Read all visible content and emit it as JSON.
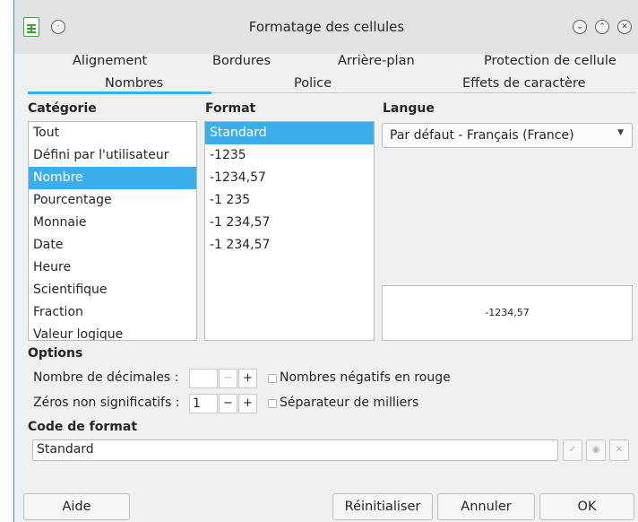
{
  "window": {
    "title": "Formatage des cellules"
  },
  "tabs_row1": [
    "Alignement",
    "Bordures",
    "Arrière-plan",
    "Protection de cellule"
  ],
  "tabs_row2": [
    "Nombres",
    "Police",
    "Effets de caractère"
  ],
  "active_tab": "Nombres",
  "category": {
    "header": "Catégorie",
    "items": [
      "Tout",
      "Défini par l'utilisateur",
      "Nombre",
      "Pourcentage",
      "Monnaie",
      "Date",
      "Heure",
      "Scientifique",
      "Fraction",
      "Valeur logique"
    ],
    "selected": "Nombre"
  },
  "format": {
    "header": "Format",
    "items": [
      "Standard",
      "-1235",
      "-1234,57",
      "-1 235",
      "-1 234,57",
      "-1 234,57"
    ],
    "selected": "Standard"
  },
  "language": {
    "header": "Langue",
    "value": "Par défaut - Français (France)"
  },
  "preview": {
    "value": "-1234,57"
  },
  "options": {
    "header": "Options",
    "decimals_label": "Nombre de décimales :",
    "decimals_value": "",
    "leading_zeros_label": "Zéros non significatifs :",
    "leading_zeros_value": "1",
    "negative_red_label": "Nombres négatifs en rouge",
    "negative_red_checked": false,
    "thousands_sep_label": "Séparateur de milliers",
    "thousands_sep_checked": false
  },
  "format_code": {
    "header": "Code de format",
    "value": "Standard"
  },
  "buttons": {
    "help": "Aide",
    "reset": "Réinitialiser",
    "cancel": "Annuler",
    "ok": "OK"
  },
  "colors": {
    "accent": "#3daee9",
    "window_bg": "#eff0f1",
    "titlebar_bg": "#e2e3e5"
  },
  "icons": [
    "calc-app-icon",
    "pin-icon",
    "minimize-icon",
    "maximize-icon",
    "close-icon",
    "accept-icon",
    "comment-icon",
    "delete-icon"
  ]
}
